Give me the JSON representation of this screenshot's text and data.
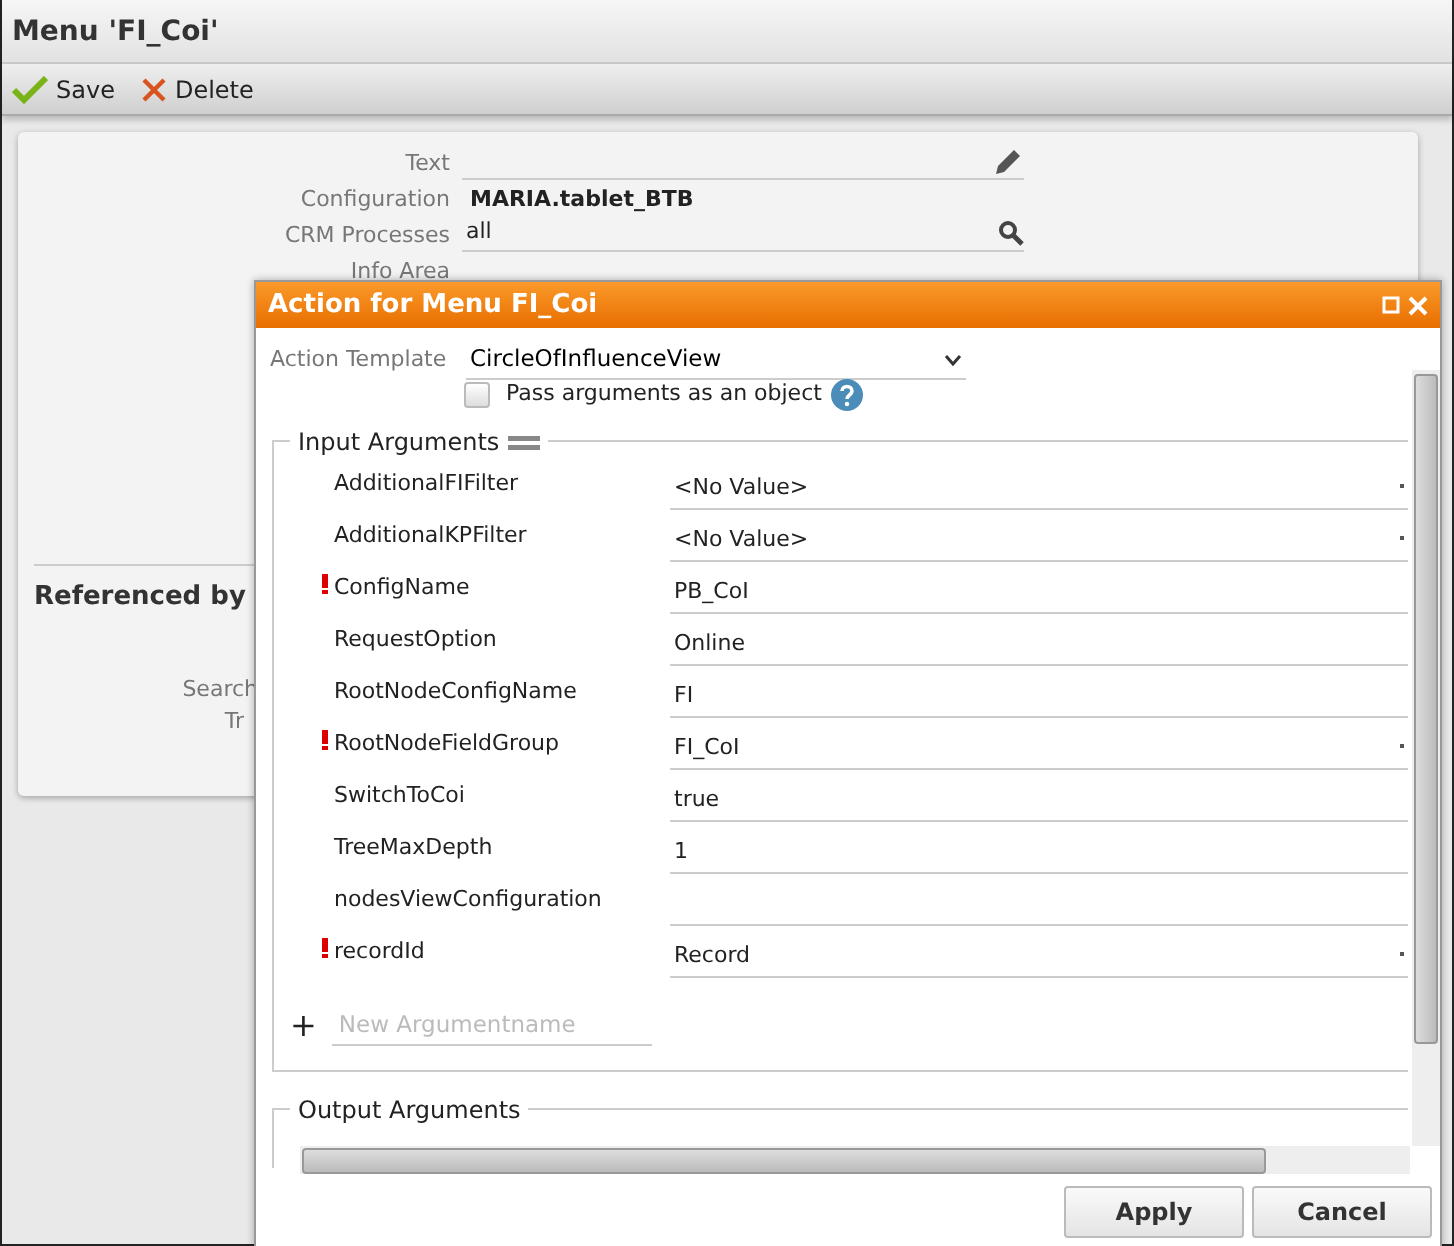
{
  "window": {
    "title": "Menu 'FI_Coi'"
  },
  "toolbar": [
    {
      "kind": "save",
      "label": "Save"
    },
    {
      "kind": "delete",
      "label": "Delete"
    }
  ],
  "form": {
    "fields": [
      {
        "label": "Text",
        "kind": "edit"
      },
      {
        "label": "Configuration",
        "value": "MARIA.tablet_BTB",
        "kind": "bold"
      },
      {
        "label": "CRM Processes",
        "value": "all",
        "kind": "search"
      },
      {
        "label": "Info Area",
        "kind": "plain"
      }
    ],
    "section_title": "Referenced by",
    "section_labels": [
      "Search",
      "Tr"
    ]
  },
  "dialog": {
    "title": "Action for Menu FI_Coi",
    "action_template": {
      "label": "Action Template",
      "value": "CircleOfInfluenceView"
    },
    "pass_as_object": {
      "label": "Pass arguments as an object",
      "checked": false
    },
    "input_arguments": {
      "title": "Input Arguments",
      "rows": [
        {
          "name": "AdditionalFIFilter",
          "value": "<No Value>",
          "required": false,
          "dropdown": true
        },
        {
          "name": "AdditionalKPFilter",
          "value": "<No Value>",
          "required": false,
          "dropdown": true
        },
        {
          "name": "ConfigName",
          "value": "PB_CoI",
          "required": true,
          "dropdown": false
        },
        {
          "name": "RequestOption",
          "value": "Online",
          "required": false,
          "dropdown": false
        },
        {
          "name": "RootNodeConfigName",
          "value": "FI",
          "required": false,
          "dropdown": false
        },
        {
          "name": "RootNodeFieldGroup",
          "value": "FI_CoI",
          "required": true,
          "dropdown": true
        },
        {
          "name": "SwitchToCoi",
          "value": "true",
          "required": false,
          "dropdown": false
        },
        {
          "name": "TreeMaxDepth",
          "value": "1",
          "required": false,
          "dropdown": false
        },
        {
          "name": "nodesViewConfiguration",
          "value": "",
          "required": false,
          "dropdown": false
        },
        {
          "name": "recordId",
          "value": "Record",
          "required": true,
          "dropdown": true
        }
      ],
      "new_argument": {
        "add_symbol": "+",
        "placeholder": "New Argumentname"
      }
    },
    "output_arguments": {
      "title": "Output Arguments"
    },
    "buttons": [
      "Apply",
      "Cancel"
    ]
  }
}
